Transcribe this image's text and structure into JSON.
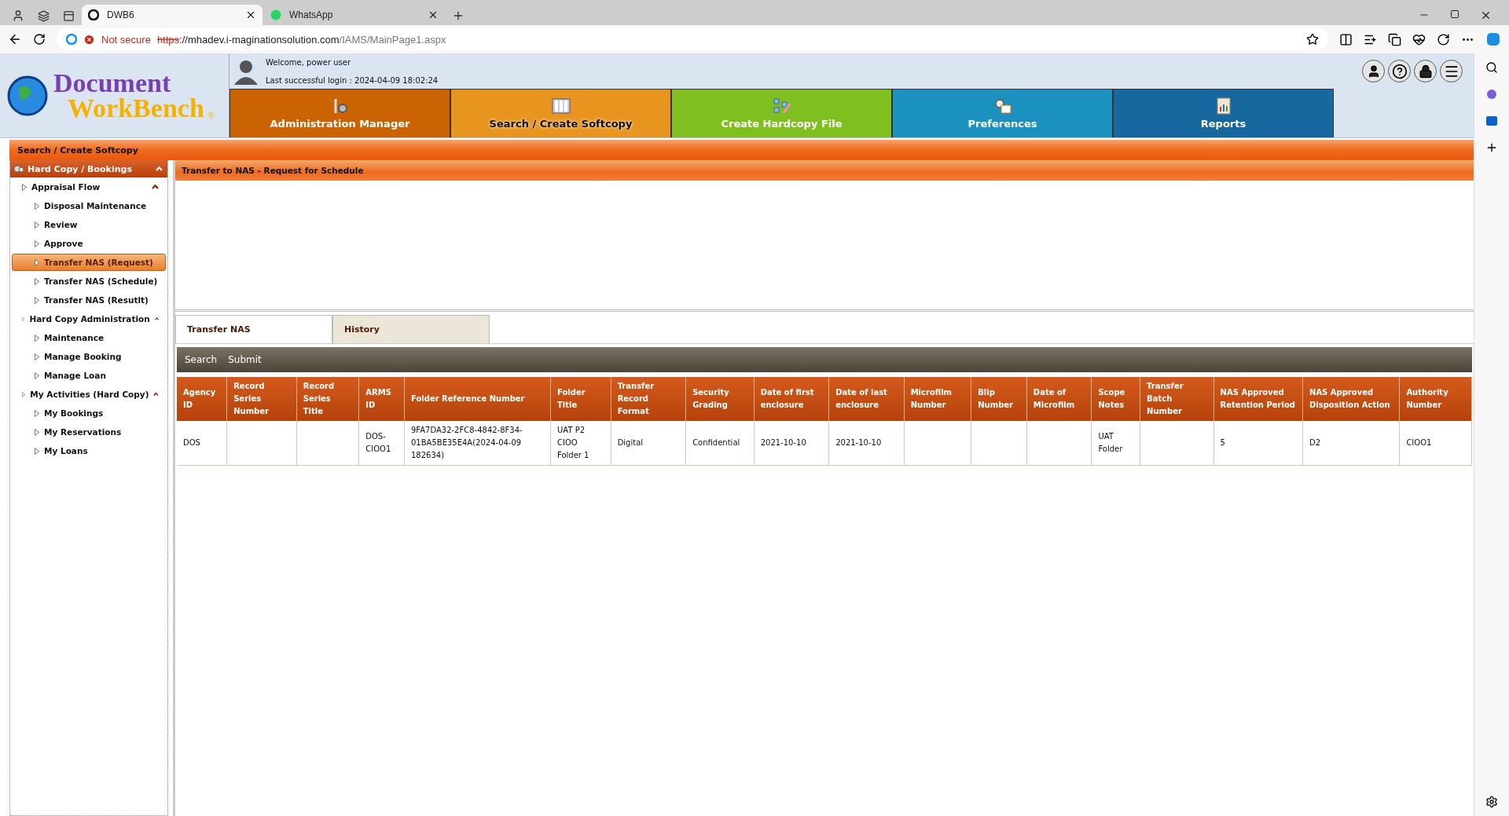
{
  "browser": {
    "tabs": [
      {
        "title": "DWB6",
        "selected": true,
        "kind": "edge"
      },
      {
        "title": "WhatsApp",
        "selected": false,
        "kind": "whatsapp"
      }
    ],
    "address": {
      "security": "Not secure",
      "scheme": "https",
      "host": "://mhadev.i-maginationsolution.com",
      "path": "/IAMS/MainPage1.aspx"
    }
  },
  "header": {
    "logo": {
      "line1": "Document",
      "line2": "WorkBench",
      "mark": "®"
    },
    "welcome": "Welcome, power user",
    "last_login": "Last successful login : 2024-04-09 18:02:24",
    "nav_tabs": [
      {
        "label": "Administration Manager",
        "selected": false,
        "color": "#cc6302",
        "kind": "tools"
      },
      {
        "label": "Search / Create Softcopy",
        "selected": true,
        "color": "#e8951f",
        "kind": "binders"
      },
      {
        "label": "Create Hardcopy File",
        "selected": false,
        "color": "#7fbf1f",
        "kind": "diagram"
      },
      {
        "label": "Preferences",
        "selected": false,
        "color": "#1a91bf",
        "kind": "gear"
      },
      {
        "label": "Reports",
        "selected": false,
        "color": "#17689f",
        "kind": "report"
      }
    ]
  },
  "breadcrumb": "Search / Create Softcopy",
  "sidebar": {
    "title": "Hard Copy / Bookings",
    "items": [
      {
        "label": "Appraisal Flow",
        "expanded": true,
        "selected": false,
        "children": [
          {
            "label": "Disposal Maintenance",
            "selected": false
          },
          {
            "label": "Review",
            "selected": false
          },
          {
            "label": "Approve",
            "selected": false
          },
          {
            "label": "Transfer NAS (Request)",
            "selected": true
          },
          {
            "label": "Transfer NAS (Schedule)",
            "selected": false
          },
          {
            "label": "Transfer NAS (Resutlt)",
            "selected": false
          }
        ]
      },
      {
        "label": "Hard Copy Administration",
        "expanded": true,
        "selected": false,
        "children": [
          {
            "label": "Maintenance",
            "selected": false
          },
          {
            "label": "Manage Booking",
            "selected": false
          },
          {
            "label": "Manage Loan",
            "selected": false
          }
        ]
      },
      {
        "label": "My Activities (Hard Copy)",
        "expanded": true,
        "selected": false,
        "children": [
          {
            "label": "My Bookings",
            "selected": false
          },
          {
            "label": "My Reservations",
            "selected": false
          },
          {
            "label": "My Loans",
            "selected": false
          }
        ]
      }
    ]
  },
  "panel": {
    "title": "Transfer to NAS - Request for Schedule",
    "tabs": [
      {
        "label": "Transfer NAS",
        "selected": true
      },
      {
        "label": "History",
        "selected": false
      }
    ],
    "toolbar": [
      "Search",
      "Submit"
    ],
    "table": {
      "columns": [
        "Agency ID",
        "Record Series Number",
        "Record Series Title",
        "ARMS ID",
        "Folder Reference Number",
        "Folder Title",
        "Transfer Record Format",
        "Security Grading",
        "Date of first enclosure",
        "Date of last enclosure",
        "Microfilm Number",
        "Blip Number",
        "Date of Microfilm",
        "Scope Notes",
        "Transfer Batch Number",
        "NAS Approved Retention Period",
        "NAS Approved Disposition Action",
        "Authority Number"
      ],
      "rows": [
        [
          "DOS",
          "",
          "",
          "DOS-CIOO1",
          "9FA7DA32-2FC8-4842-8F34-01BA5BE35E4A(2024-04-09 182634)",
          "UAT P2 CIOO Folder 1",
          "Digital",
          "Confidential",
          "2021-10-10",
          "2021-10-10",
          "",
          "",
          "",
          "UAT Folder",
          "",
          "5",
          "D2",
          "CIOO1"
        ]
      ]
    }
  }
}
